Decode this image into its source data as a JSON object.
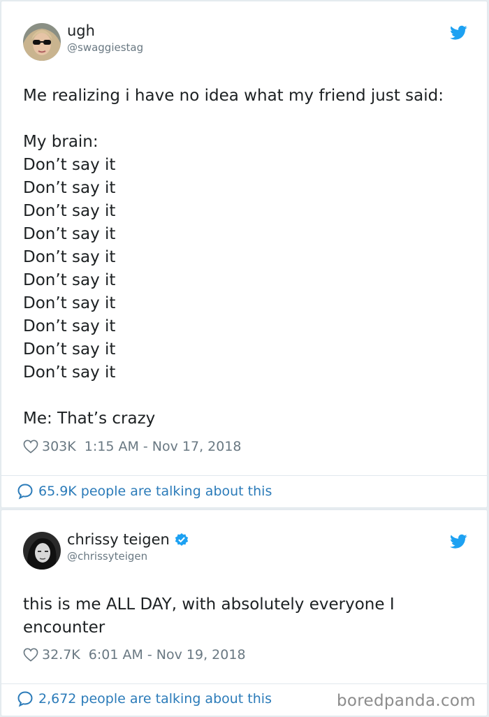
{
  "tweets": [
    {
      "author_name": "ugh",
      "author_handle": "@swaggiestag",
      "text": "Me realizing i have no idea what my friend just said:\n\nMy brain:\nDon’t say it\nDon’t say it\nDon’t say it\nDon’t say it\nDon’t say it\nDon’t say it\nDon’t say it\nDon’t say it\nDon’t say it\nDon’t say it\n\nMe: That’s crazy",
      "likes": "303K",
      "timestamp": "1:15 AM - Nov 17, 2018",
      "talking": "65.9K people are talking about this",
      "verified": false
    },
    {
      "author_name": "chrissy teigen",
      "author_handle": "@chrissyteigen",
      "text": "this is me ALL DAY, with absolutely everyone I\nencounter",
      "likes": "32.7K",
      "timestamp": "6:01 AM - Nov 19, 2018",
      "talking": "2,672 people are talking about this",
      "verified": true
    }
  ],
  "watermark": "boredpanda.com",
  "colors": {
    "twitter_blue": "#1da1f2",
    "link_blue": "#2b7bb9",
    "muted_gray": "#697882",
    "text_dark": "#1c2022"
  },
  "icons": [
    "twitter-bird-icon",
    "heart-icon",
    "speech-bubble-icon",
    "verified-badge-icon"
  ]
}
